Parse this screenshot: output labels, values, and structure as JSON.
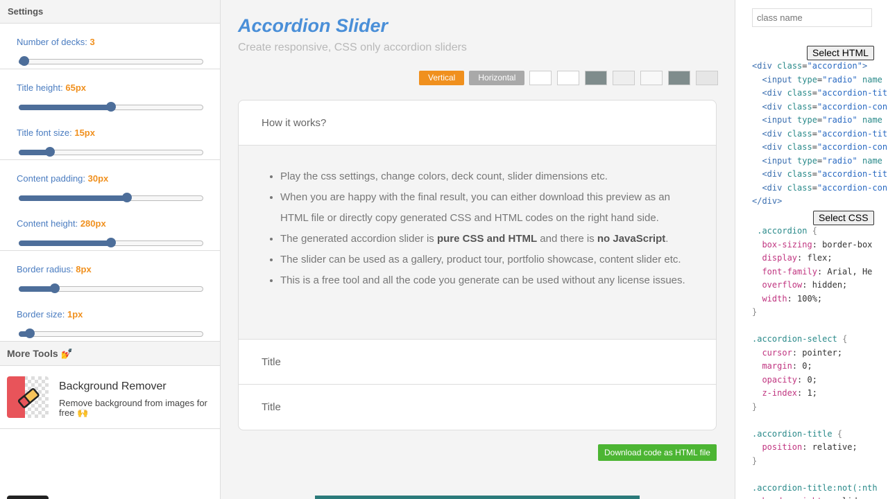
{
  "sidebar": {
    "header": "Settings",
    "settings": [
      {
        "label": "Number of decks:",
        "value": "3",
        "fraction": 0.0
      },
      {
        "label": "Title height:",
        "value": "65px",
        "fraction": 0.5
      },
      {
        "label": "Title font size:",
        "value": "15px",
        "fraction": 0.148
      },
      {
        "label": "Content padding:",
        "value": "30px",
        "fraction": 0.593
      },
      {
        "label": "Content height:",
        "value": "280px",
        "fraction": 0.5
      },
      {
        "label": "Border radius:",
        "value": "8px",
        "fraction": 0.178
      },
      {
        "label": "Border size:",
        "value": "1px",
        "fraction": 0.03
      }
    ],
    "more_tools_header": "More Tools 💅",
    "tools": [
      {
        "title": "Background Remover",
        "desc": "Remove background from images for free 🙌"
      }
    ]
  },
  "main": {
    "title": "Accordion Slider",
    "subtitle": "Create responsive, CSS only accordion sliders",
    "toolbar": {
      "vertical": "Vertical",
      "horizontal": "Horizontal"
    },
    "swatches": [
      "#ffffff",
      "#ffffff",
      "#7f8c8c",
      "#eeeeee",
      "#f8f8f8",
      "#7f8c8c",
      "#e6e6e6"
    ],
    "accordion": {
      "first_title": "How it works?",
      "bullets": [
        {
          "text": "Play the css settings, change colors, deck count, slider dimensions etc."
        },
        {
          "text": "When you are happy with the final result, you can either download this preview as an HTML file or directly copy generated CSS and HTML codes on the right hand side."
        },
        {
          "pre": "The generated accordion slider is ",
          "bold1": "pure CSS and HTML",
          "mid": " and there is ",
          "bold2": "no JavaScript",
          "post": "."
        },
        {
          "text": "The slider can be used as a gallery, product tour, portfolio showcase, content slider etc."
        },
        {
          "text": "This is a free tool and all the code you generate can be used without any license issues."
        }
      ],
      "title2": "Title",
      "title3": "Title"
    },
    "download_label": "Download code as HTML file"
  },
  "right": {
    "class_placeholder": "class name",
    "select_html": "Select HTML",
    "select_css": "Select CSS"
  },
  "colors": {
    "accent_orange": "#f0901e",
    "accent_blue": "#4a8fd8",
    "slider": "#4d6e9a",
    "download_green": "#4cb533"
  }
}
